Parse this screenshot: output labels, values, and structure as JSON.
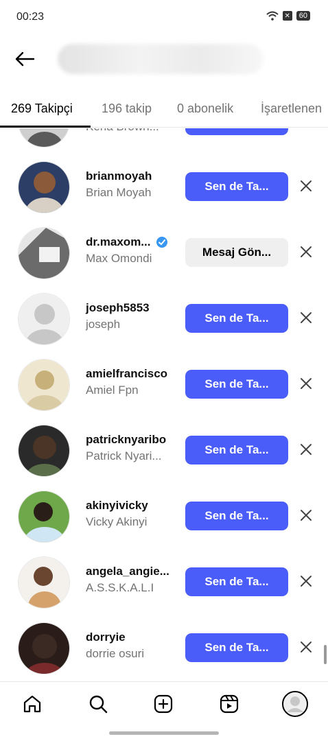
{
  "status_bar": {
    "time": "00:23",
    "battery": "60"
  },
  "header": {
    "back_icon": "arrow-left-icon"
  },
  "tabs": [
    {
      "label": "269 Takipçi",
      "active": true
    },
    {
      "label": "196 takip",
      "active": false
    },
    {
      "label": "0 abonelik",
      "active": false
    },
    {
      "label": "İşaretlenen",
      "active": false
    }
  ],
  "list": [
    {
      "username": "",
      "fullname": "Kena Brown...",
      "button": "",
      "verified": false,
      "avatar_color": "#5a5a5a"
    },
    {
      "username": "brianmoyah",
      "fullname": "Brian Moyah",
      "button": "Sen de Ta...",
      "verified": false,
      "avatar_color": "#8a5a3a"
    },
    {
      "username": "dr.maxom...",
      "fullname": "Max Omondi",
      "button": "Mesaj Gön...",
      "verified": true,
      "avatar_color": "#6b6b6b"
    },
    {
      "username": "joseph5853",
      "fullname": "joseph",
      "button": "Sen de Ta...",
      "verified": false,
      "avatar_color": "default"
    },
    {
      "username": "amielfrancisco",
      "fullname": "Amiel Fpn",
      "button": "Sen de Ta...",
      "verified": false,
      "avatar_color": "#c7b07a"
    },
    {
      "username": "patricknyaribo",
      "fullname": "Patrick Nyari...",
      "button": "Sen de Ta...",
      "verified": false,
      "avatar_color": "#4a3526"
    },
    {
      "username": "akinyivicky",
      "fullname": "Vicky Akinyi",
      "button": "Sen de Ta...",
      "verified": false,
      "avatar_color": "#6fa84a"
    },
    {
      "username": "angela_angie...",
      "fullname": "A.S.S.K.A.L.I",
      "button": "Sen de Ta...",
      "verified": false,
      "avatar_color": "#d4a26a"
    },
    {
      "username": "dorryie",
      "fullname": "dorrie osuri",
      "button": "Sen de Ta...",
      "verified": false,
      "avatar_color": "#3b2a24"
    }
  ],
  "colors": {
    "accent": "#4a5df9",
    "secondary_button": "#efefef",
    "muted_text": "#737373"
  },
  "bottom_nav": [
    "home-icon",
    "search-icon",
    "create-icon",
    "reels-icon",
    "profile-icon"
  ]
}
